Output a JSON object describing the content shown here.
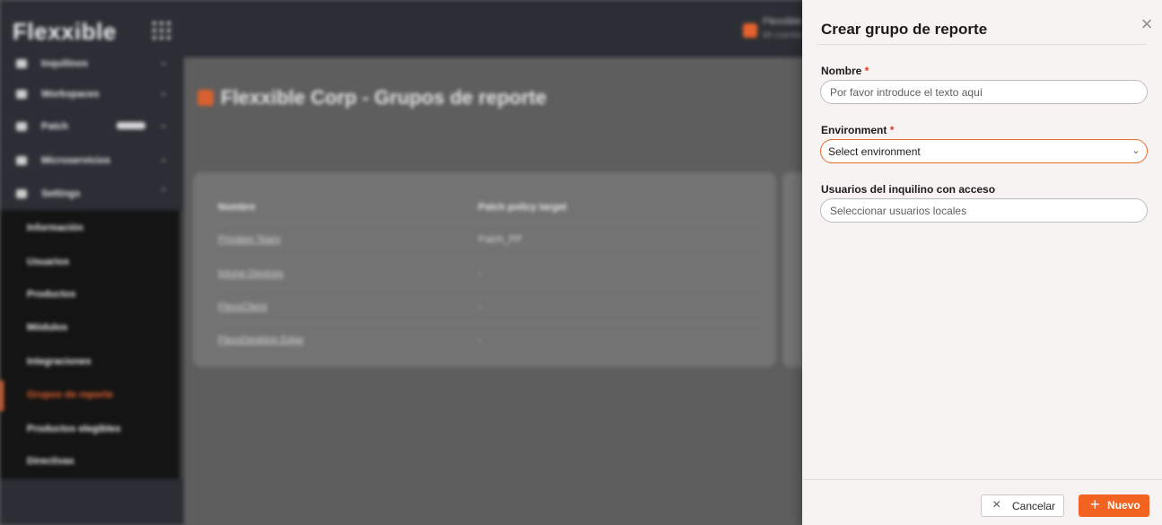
{
  "background": {
    "logo": "Flexxible",
    "user_chip": {
      "name": "Flexxible",
      "subtitle": "Mi cuenta"
    },
    "sidebar": {
      "items": [
        {
          "label": "Inquilinos",
          "icon": "users-icon"
        },
        {
          "label": "Workspaces",
          "icon": "monitor-icon"
        },
        {
          "label": "Patch",
          "icon": "patch-icon"
        },
        {
          "label": "Microservicios",
          "icon": "microservices-icon"
        },
        {
          "label": "Settings",
          "icon": "settings-icon"
        }
      ],
      "sub_items": [
        {
          "label": "Información"
        },
        {
          "label": "Usuarios"
        },
        {
          "label": "Productos"
        },
        {
          "label": "Módulos"
        },
        {
          "label": "Integraciones"
        },
        {
          "label": "Grupos de reporte",
          "active": true
        },
        {
          "label": "Productos elegibles"
        },
        {
          "label": "Directivas"
        }
      ]
    },
    "page_title": "Flexxible Corp - Grupos de reporte",
    "table": {
      "headers": [
        "Nombre",
        "Patch policy target"
      ],
      "rows": [
        [
          "Privates Team",
          "Patch_PP"
        ],
        [
          "Intune Devices",
          "-"
        ],
        [
          "FlexxClient",
          "-"
        ],
        [
          "FlexxDesktop Edge",
          "-"
        ]
      ]
    }
  },
  "drawer": {
    "title": "Crear grupo de reporte",
    "fields": {
      "nombre": {
        "label": "Nombre",
        "required": "*",
        "placeholder": "Por favor introduce el texto aquí",
        "value": ""
      },
      "environment": {
        "label": "Environment",
        "required": "*",
        "value": "Select environment"
      },
      "usuarios": {
        "label": "Usuarios del inquilino con acceso",
        "placeholder": "Seleccionar usuarios locales",
        "value": ""
      }
    },
    "buttons": {
      "cancel": {
        "label": "Cancelar",
        "icon": "close-icon"
      },
      "create": {
        "label": "Nuevo",
        "icon": "plus-icon"
      }
    }
  },
  "colors": {
    "accent": "#f26322",
    "required": "#e0382a",
    "drawer_bg": "#f6f3f2"
  }
}
